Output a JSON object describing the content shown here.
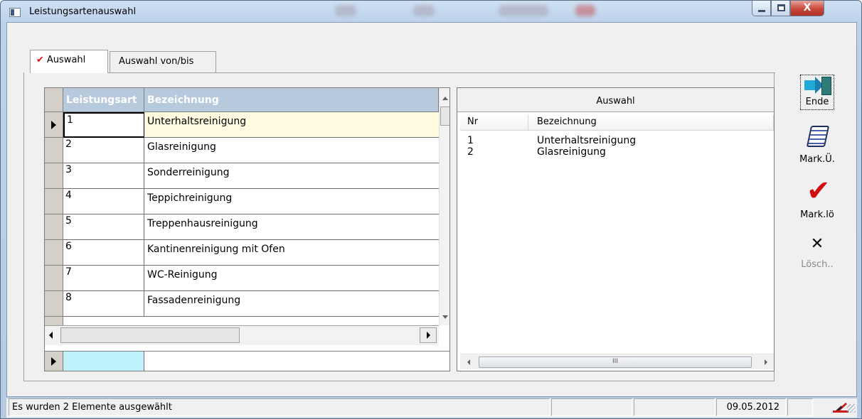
{
  "window": {
    "title": "Leistungsartenauswahl",
    "close_glyph": "X"
  },
  "tabs": [
    {
      "label": "Auswahl",
      "active": true,
      "icon": "red-check-icon"
    },
    {
      "label": "Auswahl von/bis",
      "active": false
    }
  ],
  "grid": {
    "columns": [
      "Leistungsart",
      "Bezeichnung"
    ],
    "rows": [
      {
        "id": "1",
        "name": "Unterhaltsreinigung"
      },
      {
        "id": "2",
        "name": "Glasreinigung"
      },
      {
        "id": "3",
        "name": "Sonderreinigung"
      },
      {
        "id": "4",
        "name": "Teppichreinigung"
      },
      {
        "id": "5",
        "name": "Treppenhausreinigung"
      },
      {
        "id": "6",
        "name": "Kantinenreinigung mit Ofen"
      },
      {
        "id": "7",
        "name": "WC-Reinigung"
      },
      {
        "id": "8",
        "name": "Fassadenreinigung"
      }
    ],
    "current_row": 0
  },
  "selection": {
    "title": "Auswahl",
    "columns": [
      "Nr",
      "Bezeichnung"
    ],
    "items": [
      {
        "nr": "1",
        "name": "Unterhaltsreinigung"
      },
      {
        "nr": "2",
        "name": "Glasreinigung"
      }
    ],
    "scroll_grip": "III"
  },
  "actions": [
    {
      "label": "Ende",
      "icon": "exit-door-icon",
      "enabled": true
    },
    {
      "label": "Mark.Ü.",
      "icon": "notepad-icon",
      "enabled": true
    },
    {
      "label": "Mark.lö",
      "icon": "red-check-icon",
      "enabled": true
    },
    {
      "label": "Lösch..",
      "icon": "x-icon",
      "enabled": false
    }
  ],
  "status": {
    "message": "Es wurden 2 Elemente ausgewählt",
    "date": "09.05.2012"
  },
  "colors": {
    "grid_header": "#b7c9dc",
    "current_row": "#fffbe0",
    "new_row_cell": "#bff2fa",
    "check_red": "#d00e0e"
  }
}
